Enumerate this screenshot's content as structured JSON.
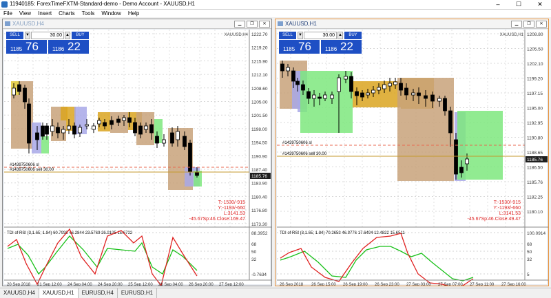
{
  "window": {
    "title": "11940185: ForexTimeFXTM-Standard-demo - Demo Account - XAUUSD,H1",
    "minimize": "–",
    "maximize": "☐",
    "close": "✕"
  },
  "menu": [
    "File",
    "View",
    "Insert",
    "Charts",
    "Tools",
    "Window",
    "Help"
  ],
  "left": {
    "frame_title": "XAUUSD,H4",
    "symbol_label": "XAUUSD,H4",
    "trade": {
      "sell": "SELL",
      "buy": "BUY",
      "lot": "30.00",
      "bid_small": "1185",
      "bid_big": "76",
      "ask_small": "1186",
      "ask_big": "22"
    },
    "price_ticks": [
      "1222.70",
      "1219.20",
      "1215.90",
      "1212.10",
      "1208.60",
      "1205.00",
      "1201.50",
      "1198.00",
      "1194.50",
      "1190.90",
      "1187.40",
      "1183.90",
      "1180.40",
      "1176.80",
      "1173.30"
    ],
    "order_sl": "#1439750606 sl",
    "order_sell": "#1439750606 sell 30.00",
    "current_price": "1185.76",
    "readout": [
      "T:-1530/-915",
      "Y:-1193/-660",
      "L:3141.53",
      "-45.67Sp:46.Close:169.47"
    ],
    "rsi_title": "TDI of RSI (3,1.65; 1.84) 60.7998 46.2844 23.5769 26.8125 15.6732",
    "rsi_ticks": [
      "88.3952",
      "68",
      "50",
      "32",
      "-0.7634"
    ],
    "time_ticks": [
      "20 Sep 2018",
      "21 Sep 12:00",
      "24 Sep 04:00",
      "24 Sep 20:00",
      "25 Sep 12:00",
      "26 Sep 04:00",
      "26 Sep 20:00",
      "27 Sep 12:00"
    ]
  },
  "right": {
    "frame_title": "XAUUSD,H1",
    "symbol_label": "XAUUSD,H1",
    "trade": {
      "sell": "SELL",
      "buy": "BUY",
      "lot": "30.00",
      "bid_small": "1185",
      "bid_big": "76",
      "ask_small": "1186",
      "ask_big": "22"
    },
    "price_ticks": [
      "1208.80",
      "1205.50",
      "1202.10",
      "1199.20",
      "1197.15",
      "1195.00",
      "1192.95",
      "1190.80",
      "1188.65",
      "1186.50",
      "1185.76",
      "1182.25",
      "1180.10"
    ],
    "order_sl": "#1439750606 sl",
    "order_sell": "#1439750606 sell 30.00",
    "current_price": "1185.76",
    "readout": [
      "T:-1530/-915",
      "Y:-1193/-660",
      "L:3141.53",
      "-45.67Sp:46.Close:49.47"
    ],
    "rsi_title": "TDI of RSI (3,1.65; 1.84) 70.3658 46.9776 17.6494 13.4822 15.6511",
    "rsi_ticks": [
      "100.0914",
      "68",
      "50",
      "32",
      "5"
    ],
    "time_ticks": [
      "26 Sep 2018",
      "26 Sep 15:00",
      "26 Sep 19:00",
      "26 Sep 23:00",
      "27 Sep 03:00",
      "27 Sep 07:00",
      "27 Sep 11:00",
      "27 Sep 16:00"
    ]
  },
  "tabs": [
    "XAUUSD,H4",
    "XAUUSD,H1",
    "EURUSD,H4",
    "EURUSD,H1"
  ],
  "colors": {
    "rsi_red": "#e0201f",
    "rsi_green": "#18c018",
    "zone_brown": "#c8a27a",
    "zone_gold": "#daa520",
    "zone_green": "#7ee87e",
    "zone_lavender": "#a8a8e8",
    "accent_frame": "#e8913a"
  }
}
